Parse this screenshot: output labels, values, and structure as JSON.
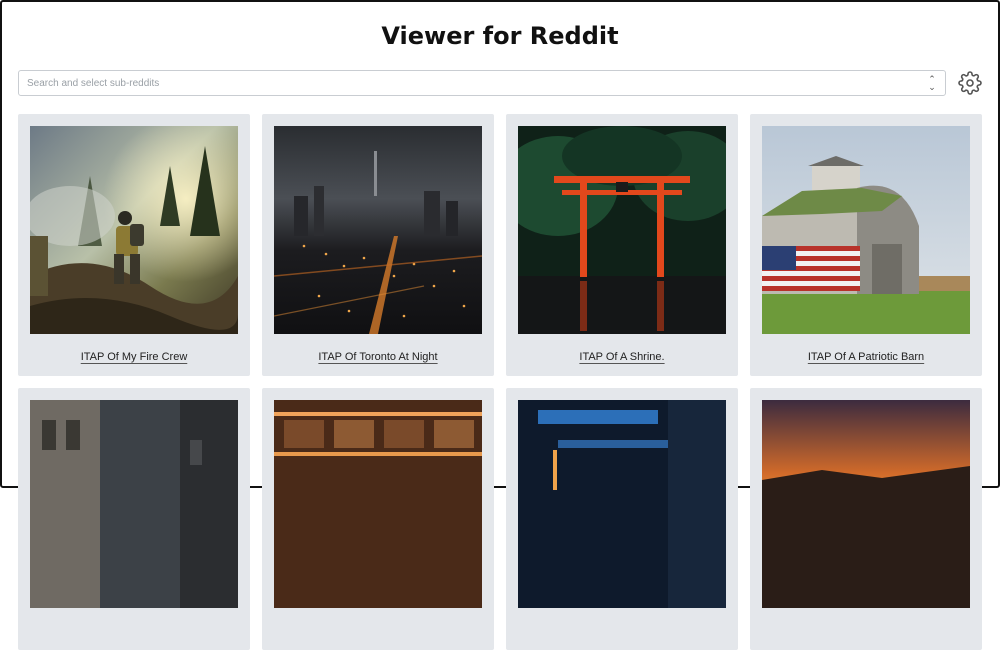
{
  "app": {
    "title": "Viewer for Reddit"
  },
  "search": {
    "placeholder": "Search and select sub-reddits",
    "value": ""
  },
  "settings": {
    "icon": "gear-icon"
  },
  "posts": [
    {
      "title": "ITAP Of My Fire Crew"
    },
    {
      "title": "ITAP Of Toronto At Night"
    },
    {
      "title": "ITAP Of A Shrine."
    },
    {
      "title": "ITAP Of A Patriotic Barn"
    },
    {
      "title": ""
    },
    {
      "title": ""
    },
    {
      "title": ""
    },
    {
      "title": ""
    }
  ]
}
